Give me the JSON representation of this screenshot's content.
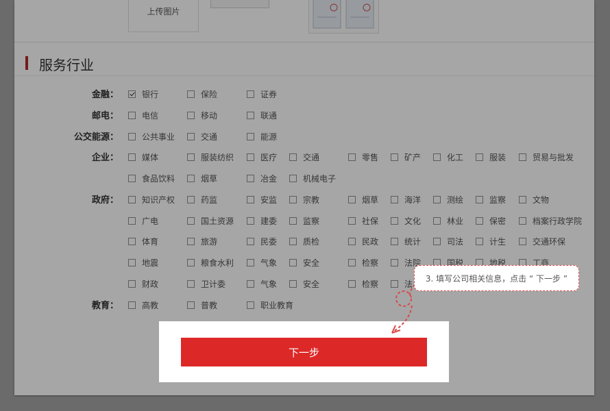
{
  "upload": {
    "label": "上传图片"
  },
  "section": {
    "title": "服务行业"
  },
  "rows": [
    {
      "label": "金融：",
      "options": [
        {
          "label": "银行",
          "checked": true
        },
        {
          "label": "保险"
        },
        {
          "label": "证券"
        }
      ]
    },
    {
      "label": "邮电：",
      "options": [
        {
          "label": "电信"
        },
        {
          "label": "移动"
        },
        {
          "label": "联通"
        }
      ]
    },
    {
      "label": "公交能源：",
      "options": [
        {
          "label": "公共事业"
        },
        {
          "label": "交通"
        },
        {
          "label": "能源"
        }
      ]
    },
    {
      "label": "企业：",
      "options": [
        {
          "label": "媒体"
        },
        {
          "label": "服装纺织"
        },
        {
          "label": "医疗"
        },
        {
          "label": "交通"
        },
        {
          "label": "零售"
        },
        {
          "label": "矿产"
        },
        {
          "label": "化工"
        },
        {
          "label": "服装"
        },
        {
          "label": "贸易与批发"
        }
      ]
    },
    {
      "label": "",
      "options": [
        {
          "label": "食品饮料"
        },
        {
          "label": "烟草"
        },
        {
          "label": "冶金"
        },
        {
          "label": "机械电子"
        }
      ]
    },
    {
      "label": "政府：",
      "options": [
        {
          "label": "知识产权"
        },
        {
          "label": "药监"
        },
        {
          "label": "安监"
        },
        {
          "label": "宗教"
        },
        {
          "label": "烟草"
        },
        {
          "label": "海洋"
        },
        {
          "label": "测绘"
        },
        {
          "label": "监察"
        },
        {
          "label": "文物"
        }
      ]
    },
    {
      "label": "",
      "options": [
        {
          "label": "广电"
        },
        {
          "label": "国土资源"
        },
        {
          "label": "建委"
        },
        {
          "label": "监察"
        },
        {
          "label": "社保"
        },
        {
          "label": "文化"
        },
        {
          "label": "林业"
        },
        {
          "label": "保密"
        },
        {
          "label": "档案行政学院"
        }
      ]
    },
    {
      "label": "",
      "options": [
        {
          "label": "体育"
        },
        {
          "label": "旅游"
        },
        {
          "label": "民委"
        },
        {
          "label": "质检"
        },
        {
          "label": "民政"
        },
        {
          "label": "统计"
        },
        {
          "label": "司法"
        },
        {
          "label": "计生"
        },
        {
          "label": "交通环保"
        }
      ]
    },
    {
      "label": "",
      "options": [
        {
          "label": "地震"
        },
        {
          "label": "粮食水利"
        },
        {
          "label": "气象"
        },
        {
          "label": "安全"
        },
        {
          "label": "检察"
        },
        {
          "label": "法院"
        },
        {
          "label": "国税"
        },
        {
          "label": "地税"
        },
        {
          "label": "工商"
        }
      ]
    },
    {
      "label": "",
      "options": [
        {
          "label": "财政"
        },
        {
          "label": "卫计委"
        },
        {
          "label": "气象"
        },
        {
          "label": "安全"
        },
        {
          "label": "检察"
        },
        {
          "label": "法"
        }
      ]
    },
    {
      "label": "教育：",
      "options": [
        {
          "label": "高教"
        },
        {
          "label": "普教"
        },
        {
          "label": "职业教育"
        }
      ]
    }
  ],
  "next_button": "下一步",
  "tooltip": "3. 填写公司相关信息，点击 “ 下一步 ”",
  "colors": {
    "accent": "#dd2828",
    "section_bar": "#b22a2a",
    "overlay": "rgba(0,0,0,0.35)"
  }
}
